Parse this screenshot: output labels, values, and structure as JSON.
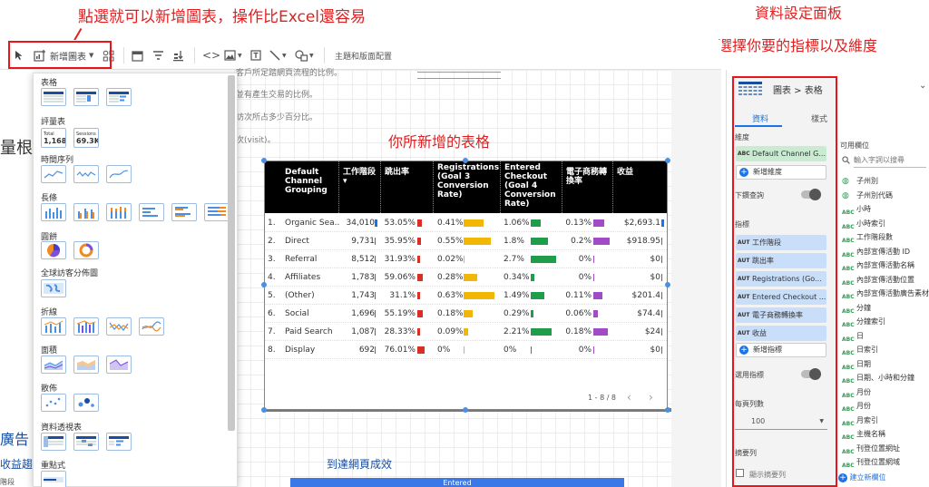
{
  "annotations": {
    "top_note": "點選就可以新增圖表，操作比Excel還容易",
    "right_title": "資料設定面板",
    "right_sub": "選擇你要的指標以及維度",
    "table_note": "你所新增的表格"
  },
  "toolbar": {
    "add_chart": "新增圖表",
    "theme": "主題和版面配置"
  },
  "bg_text": {
    "line1": "客戶所足踏網頁流程的比例。",
    "line2": "並有產生交易的比例。",
    "line3": "訪次所占多少百分比。",
    "line4": "次(visit)。",
    "heading": "量根",
    "ads": "廣告",
    "income": "收益趨",
    "stage": "階段",
    "revenue_small": "收益",
    "bottom_title": "到達網頁成效",
    "bottom_bar": "Entered"
  },
  "chart_menu": {
    "sections": [
      "表格",
      "評量表",
      "時間序列",
      "長條",
      "圓餅",
      "全球訪客分佈圖",
      "折線",
      "面積",
      "散佈",
      "資料透視表",
      "重點式"
    ],
    "scorecard_1_label": "Total",
    "scorecard_1_value": "1,168",
    "scorecard_2_label": "Sessions",
    "scorecard_2_value": "69.3K"
  },
  "table": {
    "headers": [
      "Default Channel Grouping",
      "工作階段 ▾",
      "跳出率",
      "Registrations (Goal 3 Conversion Rate)",
      "Entered Checkout (Goal 4 Conversion Rate)",
      "電子商務轉換率",
      "收益"
    ],
    "rows": [
      {
        "idx": "1.",
        "channel": "Organic Sea...",
        "sessions": "34,010",
        "bounce": "53.05%",
        "reg": "0.41%",
        "checkout": "1.06%",
        "ecom": "0.13%",
        "revenue": "$2,693.1"
      },
      {
        "idx": "2.",
        "channel": "Direct",
        "sessions": "9,731",
        "bounce": "35.95%",
        "reg": "0.55%",
        "checkout": "1.8%",
        "ecom": "0.2%",
        "revenue": "$918.95"
      },
      {
        "idx": "3.",
        "channel": "Referral",
        "sessions": "8,512",
        "bounce": "31.93%",
        "reg": "0.02%",
        "checkout": "2.7%",
        "ecom": "0%",
        "revenue": "$0"
      },
      {
        "idx": "4.",
        "channel": "Affiliates",
        "sessions": "1,783",
        "bounce": "59.06%",
        "reg": "0.28%",
        "checkout": "0.34%",
        "ecom": "0%",
        "revenue": "$0"
      },
      {
        "idx": "5.",
        "channel": "(Other)",
        "sessions": "1,743",
        "bounce": "31.1%",
        "reg": "0.63%",
        "checkout": "1.49%",
        "ecom": "0.11%",
        "revenue": "$201.4"
      },
      {
        "idx": "6.",
        "channel": "Social",
        "sessions": "1,696",
        "bounce": "55.19%",
        "reg": "0.18%",
        "checkout": "0.29%",
        "ecom": "0.06%",
        "revenue": "$74.4"
      },
      {
        "idx": "7.",
        "channel": "Paid Search",
        "sessions": "1,087",
        "bounce": "28.33%",
        "reg": "0.09%",
        "checkout": "2.21%",
        "ecom": "0.18%",
        "revenue": "$24"
      },
      {
        "idx": "8.",
        "channel": "Display",
        "sessions": "692",
        "bounce": "76.01%",
        "reg": "0%",
        "checkout": "0%",
        "ecom": "0%",
        "revenue": "$0"
      }
    ],
    "pager": "1 - 8 / 8"
  },
  "panel": {
    "breadcrumb": "圖表 > 表格",
    "tab_data": "資料",
    "tab_style": "樣式",
    "dimension_label": "維度",
    "dimension_chip": "Default Channel G...",
    "add_dimension": "新增維度",
    "drilldown": "下鑽查詢",
    "metric_label": "指標",
    "metrics": [
      "工作階段",
      "跳出率",
      "Registrations (Go...",
      "Entered Checkout ...",
      "電子商務轉換率",
      "收益"
    ],
    "add_metric": "新增指標",
    "optional_metrics": "選用指標",
    "rows_per_page": "每頁列數",
    "rows_value": "100",
    "summary": "摘要列",
    "show_summary": "顯示摘要列",
    "available_fields": "可用欄位",
    "search_placeholder": "輸入字詞以搜尋",
    "fields": [
      "子州別",
      "子州別代碼",
      "小時",
      "小時索引",
      "工作階段數",
      "內部宣傳活動 ID",
      "內部宣傳活動名稱",
      "內部宣傳活動位置",
      "內部宣傳活動廣告素材",
      "分鐘",
      "分鐘索引",
      "日",
      "日索引",
      "日期",
      "日期、小時和分鐘",
      "月份",
      "月份",
      "月索引",
      "主機名稱",
      "刊登位置網址",
      "刊登位置網域"
    ],
    "create_field": "建立新欄位"
  },
  "colors": {
    "bounce": "#d93025",
    "reg": "#f2b705",
    "checkout": "#1e9e4a",
    "ecom": "#a14bc9",
    "revenue": "#1a73e8",
    "highlight": "#e8161b"
  }
}
